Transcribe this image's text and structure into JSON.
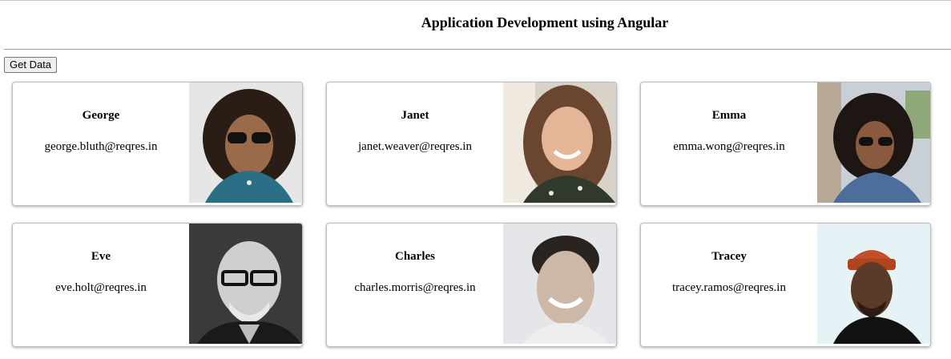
{
  "header": {
    "title": "Application Development using Angular"
  },
  "toolbar": {
    "get_data_label": "Get Data"
  },
  "users": [
    {
      "first_name": "George",
      "email": "george.bluth@reqres.in",
      "avatar": "avatar-george-photo"
    },
    {
      "first_name": "Janet",
      "email": "janet.weaver@reqres.in",
      "avatar": "avatar-janet-photo"
    },
    {
      "first_name": "Emma",
      "email": "emma.wong@reqres.in",
      "avatar": "avatar-emma-photo"
    },
    {
      "first_name": "Eve",
      "email": "eve.holt@reqres.in",
      "avatar": "avatar-eve-photo"
    },
    {
      "first_name": "Charles",
      "email": "charles.morris@reqres.in",
      "avatar": "avatar-charles-photo"
    },
    {
      "first_name": "Tracey",
      "email": "tracey.ramos@reqres.in",
      "avatar": "avatar-tracey-photo"
    }
  ]
}
